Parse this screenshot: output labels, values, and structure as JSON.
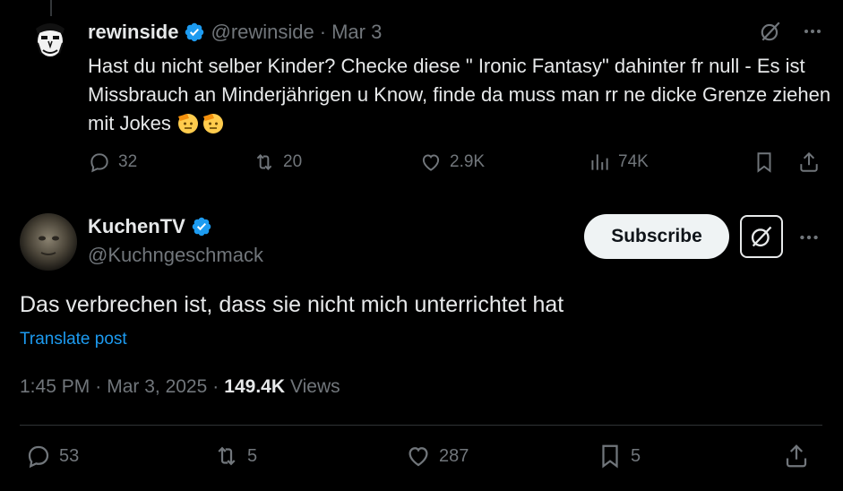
{
  "context_tweet": {
    "display_name": "rewinside",
    "handle": "@rewinside",
    "separator": "·",
    "date": "Mar 3",
    "text": "Hast du nicht selber Kinder? Checke diese \" Ironic Fantasy\" dahinter fr null - Es ist Missbrauch an Minderjährigen u Know, finde da muss man rr ne dicke Grenze ziehen mit Jokes",
    "actions": {
      "replies": "32",
      "reposts": "20",
      "likes": "2.9K",
      "views": "74K"
    }
  },
  "main_tweet": {
    "display_name": "KuchenTV",
    "handle": "@Kuchngeschmack",
    "subscribe_label": "Subscribe",
    "text": "Das verbrechen ist, dass sie nicht mich unterrichtet hat",
    "translate_label": "Translate post",
    "time": "1:45 PM",
    "sep1": "·",
    "date": "Mar 3, 2025",
    "sep2": "·",
    "views_count": "149.4K",
    "views_label": "Views",
    "actions": {
      "replies": "53",
      "reposts": "5",
      "likes": "287",
      "bookmarks": "5"
    }
  },
  "colors": {
    "background": "#000000",
    "text_primary": "#e7e9ea",
    "text_secondary": "#71767b",
    "link": "#1d9bf0",
    "verified": "#1d9bf0",
    "divider": "#2f3336"
  }
}
